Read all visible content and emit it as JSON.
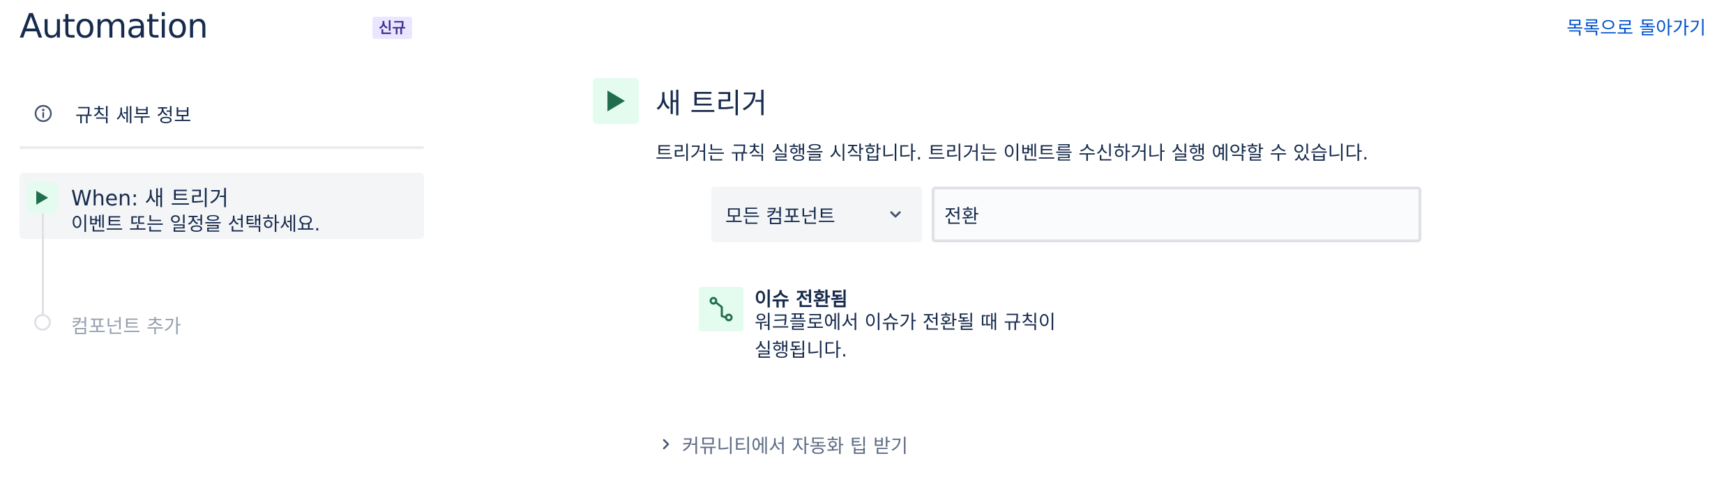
{
  "header": {
    "title": "Automation",
    "badge": "신규",
    "back_link": "목록으로 돌아가기"
  },
  "sidebar": {
    "rule_details_label": "규칙 세부 정보",
    "when": {
      "title": "When: 새 트리거",
      "subtitle": "이벤트 또는 일정을 선택하세요."
    },
    "add_component_label": "컴포넌트 추가"
  },
  "main": {
    "heading": "새 트리거",
    "description": "트리거는 규칙 실행을 시작합니다. 트리거는 이벤트를 수신하거나 실행 예약할 수 있습니다.",
    "filter": {
      "selected": "모든 컴포넌트"
    },
    "search": {
      "value": "전환",
      "placeholder": ""
    },
    "results": [
      {
        "title": "이슈 전환됨",
        "description": "워크플로에서 이슈가 전환될 때 규칙이 실행됩니다.",
        "icon": "transition-icon"
      }
    ],
    "community_tips_label": "커뮤니티에서 자동화 팁 받기"
  },
  "colors": {
    "accent": "#0052cc",
    "trigger_green": "#216e4e",
    "trigger_bg": "#e3fcef",
    "badge_bg": "#eae6ff"
  }
}
